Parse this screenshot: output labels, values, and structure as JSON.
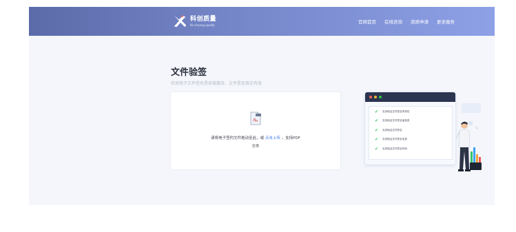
{
  "header": {
    "logo_name": "科创质量",
    "logo_sub": "Ke chuang quality",
    "nav": [
      "官网首页",
      "在线咨询",
      "资质申请",
      "更多服务"
    ]
  },
  "main": {
    "title": "文件验签",
    "subtitle": "检测电子文件签名是否被篡改、文件是否真实有效",
    "upload": {
      "text_before": "请将电子签约文件拖动至此，或",
      "link": "点击上传",
      "text_after": "，支持PDF",
      "text_line2": "文件"
    }
  },
  "illustration": {
    "checks": [
      "支持验证文件签名有效性",
      "支持验证文件签名者信息",
      "支持验证文件签名",
      "支持验证文件签名信息",
      "支持验证文件签名时间"
    ]
  },
  "colors": {
    "header_start": "#5b6aa8",
    "header_end": "#8ea0e6",
    "link": "#3a7bf0",
    "check": "#33c25a"
  }
}
